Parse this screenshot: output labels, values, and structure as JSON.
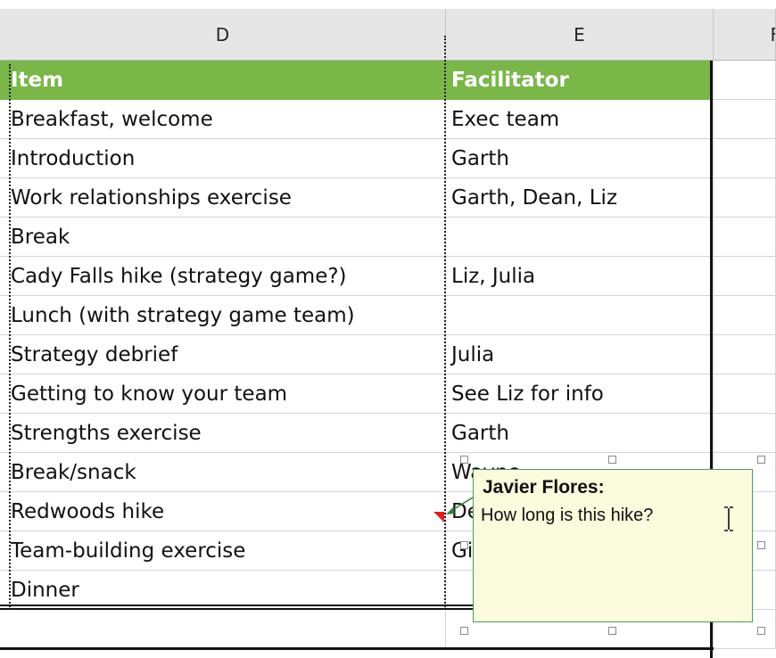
{
  "columns": {
    "d": "D",
    "e": "E",
    "f": "F"
  },
  "header": {
    "item": "Item",
    "facilitator": "Facilitator"
  },
  "rows": [
    {
      "item": "Breakfast, welcome",
      "facilitator": "Exec team"
    },
    {
      "item": "Introduction",
      "facilitator": "Garth"
    },
    {
      "item": "Work relationships exercise",
      "facilitator": "Garth, Dean, Liz"
    },
    {
      "item": "Break",
      "facilitator": ""
    },
    {
      "item": "Cady Falls hike (strategy game?)",
      "facilitator": "Liz, Julia"
    },
    {
      "item": "Lunch (with strategy game team)",
      "facilitator": ""
    },
    {
      "item": "Strategy debrief",
      "facilitator": "Julia"
    },
    {
      "item": "Getting to know your team",
      "facilitator": "See Liz for info"
    },
    {
      "item": "Strengths exercise",
      "facilitator": "Garth"
    },
    {
      "item": "Break/snack",
      "facilitator": "Wayne"
    },
    {
      "item": "Redwoods hike",
      "facilitator": "De"
    },
    {
      "item": "Team-building exercise",
      "facilitator": "Gi"
    },
    {
      "item": "Dinner",
      "facilitator": ""
    }
  ],
  "comment": {
    "author": "Javier Flores:",
    "text": "How long is this hike?"
  },
  "colors": {
    "header_fill": "#7ab648",
    "comment_fill": "#fbfbdd",
    "comment_border": "#4f9a5a",
    "indicator": "#e02020"
  }
}
